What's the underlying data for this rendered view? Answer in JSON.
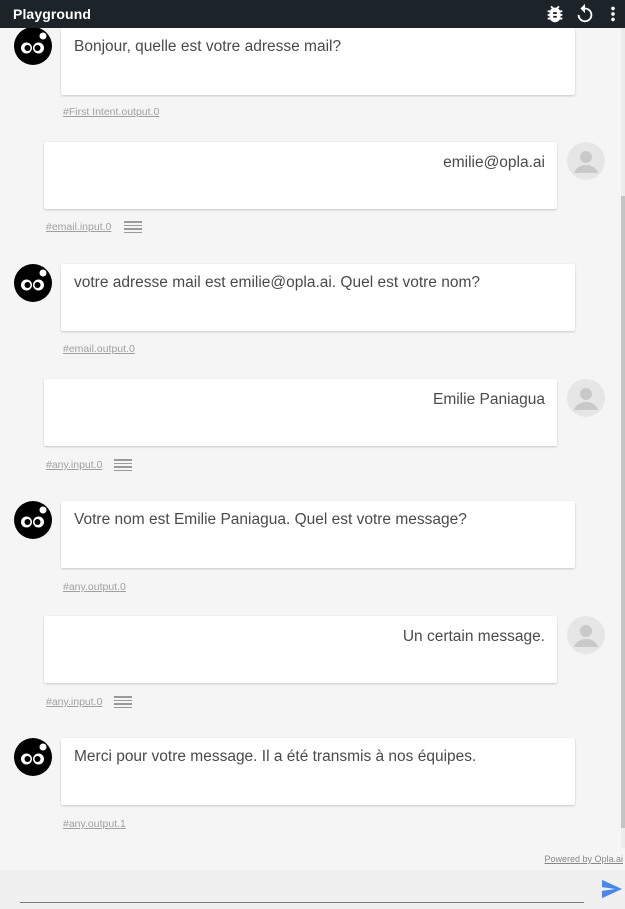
{
  "app": {
    "title": "Playground",
    "icons": [
      "bug-icon",
      "refresh-icon",
      "more-vert-icon"
    ]
  },
  "messages": [
    {
      "from": "bot",
      "text": "Bonjour, quelle est votre adresse mail?",
      "meta": "#First Intent.output.0"
    },
    {
      "from": "user",
      "text": "emilie@opla.ai",
      "meta": "#email.input.0"
    },
    {
      "from": "bot",
      "text": "votre adresse mail est emilie@opla.ai. Quel est votre nom?",
      "meta": "#email.output.0"
    },
    {
      "from": "user",
      "text": "Emilie Paniagua",
      "meta": "#any.input.0"
    },
    {
      "from": "bot",
      "text": "Votre nom est Emilie Paniagua. Quel est votre message?",
      "meta": "#any.output.0"
    },
    {
      "from": "user",
      "text": "Un certain message.",
      "meta": "#any.input.0"
    },
    {
      "from": "bot",
      "text": "Merci pour votre message. Il a été transmis à nos équipes.",
      "meta": "#any.output.1"
    }
  ],
  "footer": {
    "powered_by": "Powered by Opla.ai",
    "input_value": "",
    "input_placeholder": ""
  },
  "colors": {
    "topbar": "#1c2329",
    "send_icon": "#4a86e8",
    "page_bg": "#f5f5f5"
  }
}
